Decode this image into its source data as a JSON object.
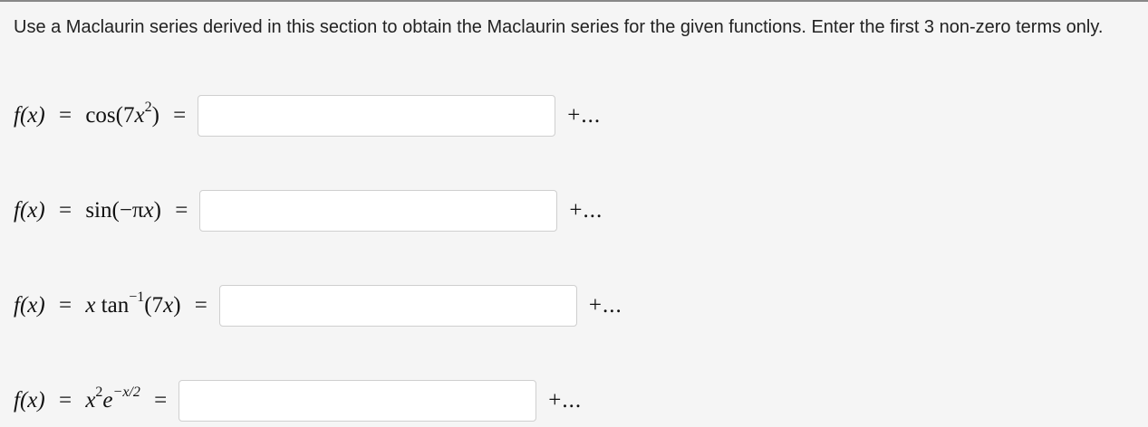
{
  "instructions": "Use a Maclaurin series derived in this section to obtain the Maclaurin series for the given functions. Enter the first 3 non-zero terms only.",
  "problems": [
    {
      "lhs": "f(x)",
      "fn": "cos",
      "arg_open": "(7",
      "arg_var": "x",
      "arg_exp": "2",
      "arg_close": ")",
      "equals": "=",
      "answer_value": "",
      "tail": "+..."
    },
    {
      "lhs": "f(x)",
      "fn": "sin",
      "arg_open": "(−π",
      "arg_var": "x",
      "arg_close": ")",
      "equals": "=",
      "answer_value": "",
      "tail": "+..."
    },
    {
      "lhs": "f(x)",
      "prefix_var": "x",
      "fn": "tan",
      "fn_exp": "−1",
      "arg_open": "(7",
      "arg_var": "x",
      "arg_close": ")",
      "equals": "=",
      "answer_value": "",
      "tail": "+..."
    },
    {
      "lhs": "f(x)",
      "prefix_var": "x",
      "prefix_exp": "2",
      "base": "e",
      "base_exp": "−x/2",
      "equals": "=",
      "answer_value": "",
      "tail": "+..."
    }
  ]
}
